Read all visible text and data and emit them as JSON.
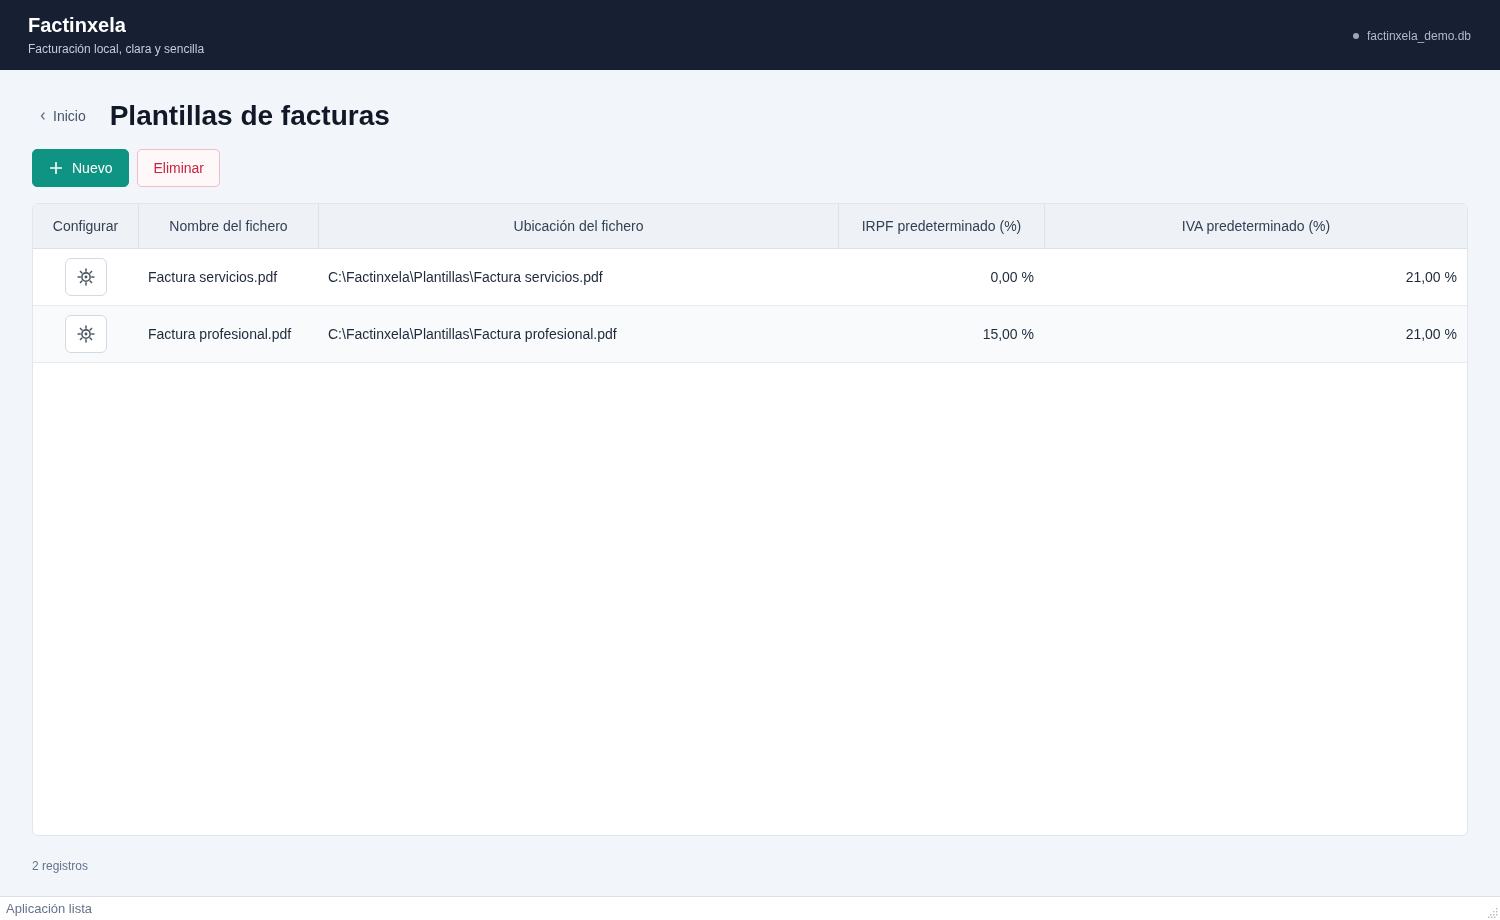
{
  "header": {
    "app_name": "Factinxela",
    "tagline": "Facturación local, clara y sencilla",
    "database": "factinxela_demo.db"
  },
  "breadcrumb": {
    "back_label": "Inicio"
  },
  "page_title": "Plantillas de facturas",
  "toolbar": [
    {
      "label": "Nuevo",
      "kind": "primary"
    },
    {
      "label": "Eliminar",
      "kind": "danger"
    }
  ],
  "table": {
    "columns": [
      "Configurar",
      "Nombre del fichero",
      "Ubicación del fichero",
      "IRPF predeterminado (%)",
      "IVA predeterminado (%)"
    ],
    "rows": [
      {
        "file_name": "Factura servicios.pdf",
        "location": "C:\\Factinxela\\Plantillas\\Factura servicios.pdf",
        "irpf": "0,00 %",
        "iva": "21,00 %"
      },
      {
        "file_name": "Factura profesional.pdf",
        "location": "C:\\Factinxela\\Plantillas\\Factura profesional.pdf",
        "irpf": "15,00 %",
        "iva": "21,00 %"
      }
    ]
  },
  "footer": {
    "record_count": "2 registros"
  },
  "status_bar": {
    "message": "Aplicación lista"
  }
}
